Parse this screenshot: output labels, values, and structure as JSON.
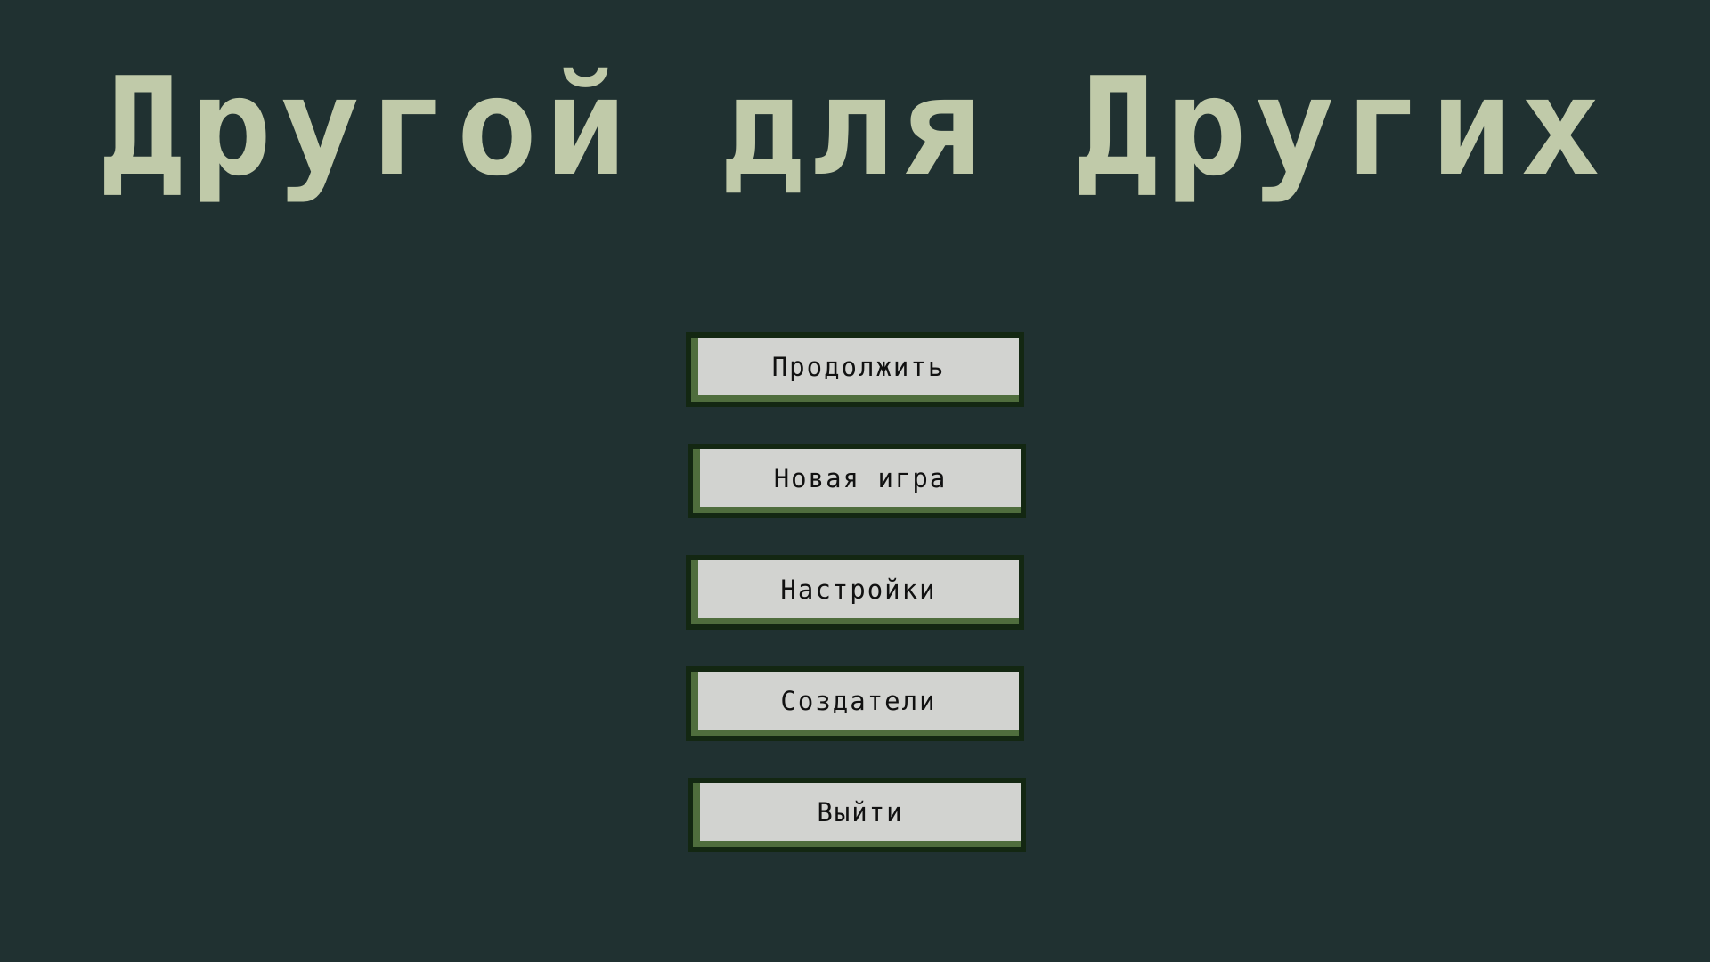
{
  "game": {
    "title": "Другой для Других"
  },
  "menu": {
    "continue_label": "Продолжить",
    "new_game_label": "Новая игра",
    "settings_label": "Настройки",
    "credits_label": "Создатели",
    "quit_label": "Выйти"
  },
  "colors": {
    "background": "#203131",
    "title": "#c0caa9",
    "button_border": "#132712",
    "button_shadow": "#4f6d3d",
    "button_face": "#d2d3d0",
    "button_text": "#111111"
  }
}
